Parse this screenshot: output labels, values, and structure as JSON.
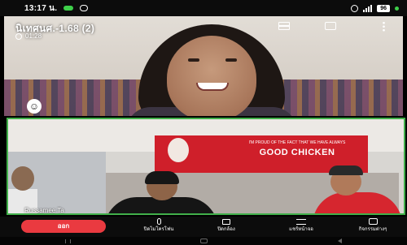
{
  "status_bar": {
    "time": "13:17 น.",
    "battery": "96"
  },
  "call": {
    "title": "นิเทศนศ.-1.68 (2)",
    "duration": "01:28"
  },
  "remote_video": {
    "emoji_glyph": "☺"
  },
  "local_video": {
    "participant_name": "Russamee Ta",
    "banner": {
      "small_text": "I'M PROUD OF THE FACT THAT WE HAVE ALWAYS",
      "headline": "GOOD CHICKEN"
    }
  },
  "controls": {
    "end_call_label": "ออก",
    "mic_label": "ปิดไมโครโฟน",
    "camera_label": "ปิดกล้อง",
    "share_label": "แชร์หน้าจอ",
    "react_label": "กิจกรรมต่างๆ"
  },
  "icons": {
    "mic": "microphone-icon",
    "camera": "video-camera-icon",
    "share": "screen-share-icon",
    "react": "reactions-icon",
    "layout": "layout-icon",
    "switch_camera": "switch-camera-icon",
    "more": "more-vertical-icon"
  },
  "colors": {
    "end_call": "#ea3a40",
    "active_speaker_border": "#41b04a",
    "banner_red": "#cf1f2a"
  }
}
